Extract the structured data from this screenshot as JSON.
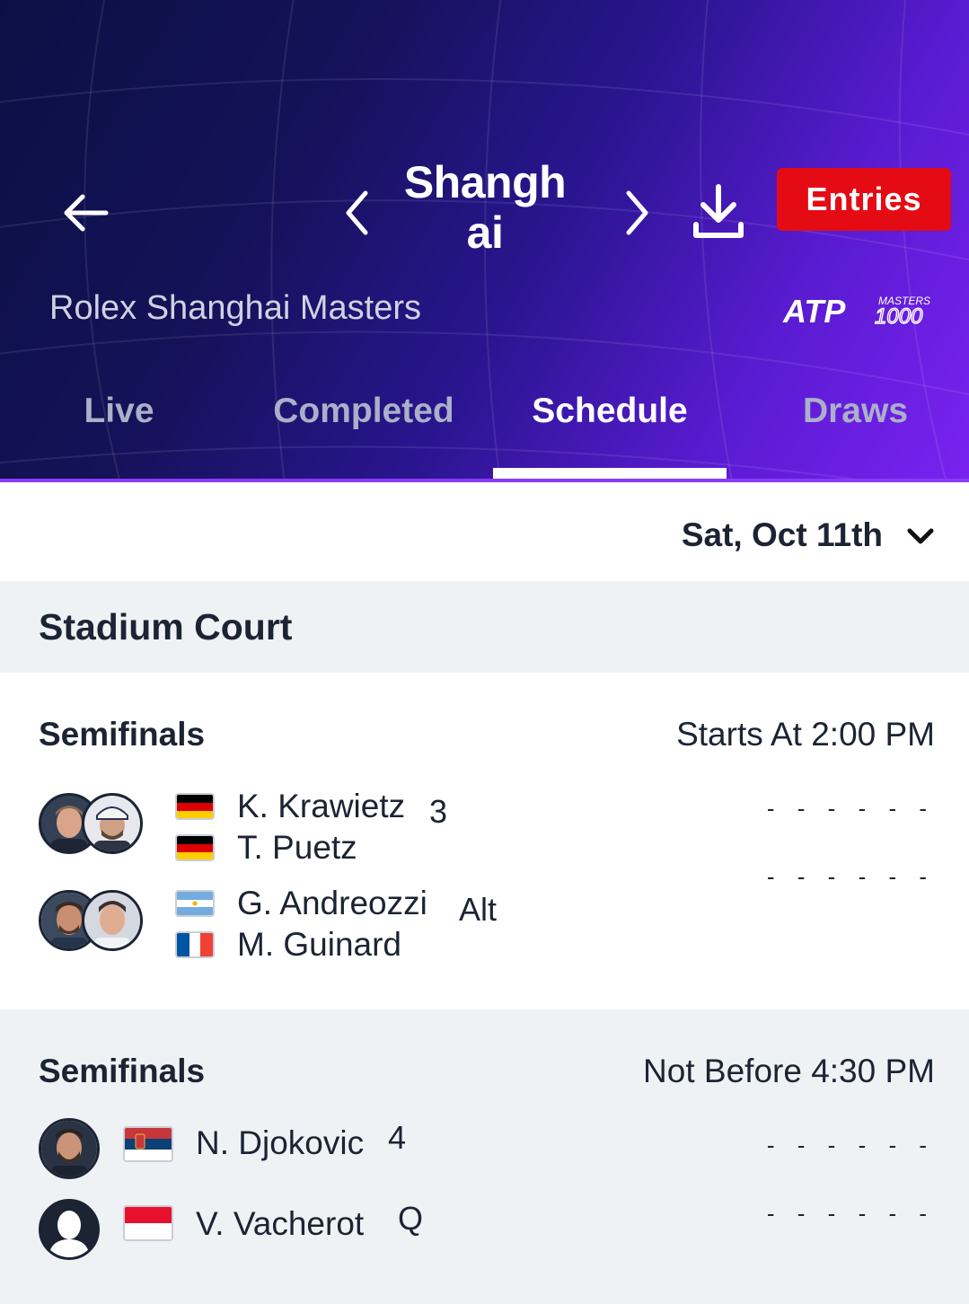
{
  "header": {
    "title": "Shanghai",
    "entries_label": "Entries",
    "tournament_name": "Rolex Shanghai Masters",
    "logo_text": "ATP",
    "logo_sub_top": "MASTERS",
    "logo_sub_num": "1000"
  },
  "tabs": [
    {
      "label": "Live"
    },
    {
      "label": "Completed"
    },
    {
      "label": "Schedule",
      "active": true
    },
    {
      "label": "Draws"
    }
  ],
  "date_selector": {
    "value": "Sat, Oct 11th"
  },
  "court": {
    "name": "Stadium Court"
  },
  "matches": [
    {
      "round": "Semifinals",
      "time": "Starts At 2:00 PM",
      "teams": [
        {
          "seed": "3",
          "players": [
            {
              "name": "K. Krawietz",
              "country": "Germany"
            },
            {
              "name": "T. Puetz",
              "country": "Germany"
            }
          ],
          "score": "- - - - - -"
        },
        {
          "seed": "Alt",
          "players": [
            {
              "name": "G. Andreozzi",
              "country": "Argentina"
            },
            {
              "name": "M. Guinard",
              "country": "France"
            }
          ],
          "score": "- - - - - -"
        }
      ]
    },
    {
      "round": "Semifinals",
      "time": "Not Before 4:30 PM",
      "teams": [
        {
          "seed": "4",
          "players": [
            {
              "name": "N. Djokovic",
              "country": "Serbia"
            }
          ],
          "score": "- - - - - -"
        },
        {
          "seed": "Q",
          "players": [
            {
              "name": "V. Vacherot",
              "country": "Monaco"
            }
          ],
          "score": "- - - - - -"
        }
      ]
    }
  ],
  "colors": {
    "header_dark": "#0b1044",
    "header_purple": "#7a22f0",
    "entries_red": "#e50b14",
    "text_dark": "#1c2433",
    "section_bg": "#eff2f5"
  }
}
